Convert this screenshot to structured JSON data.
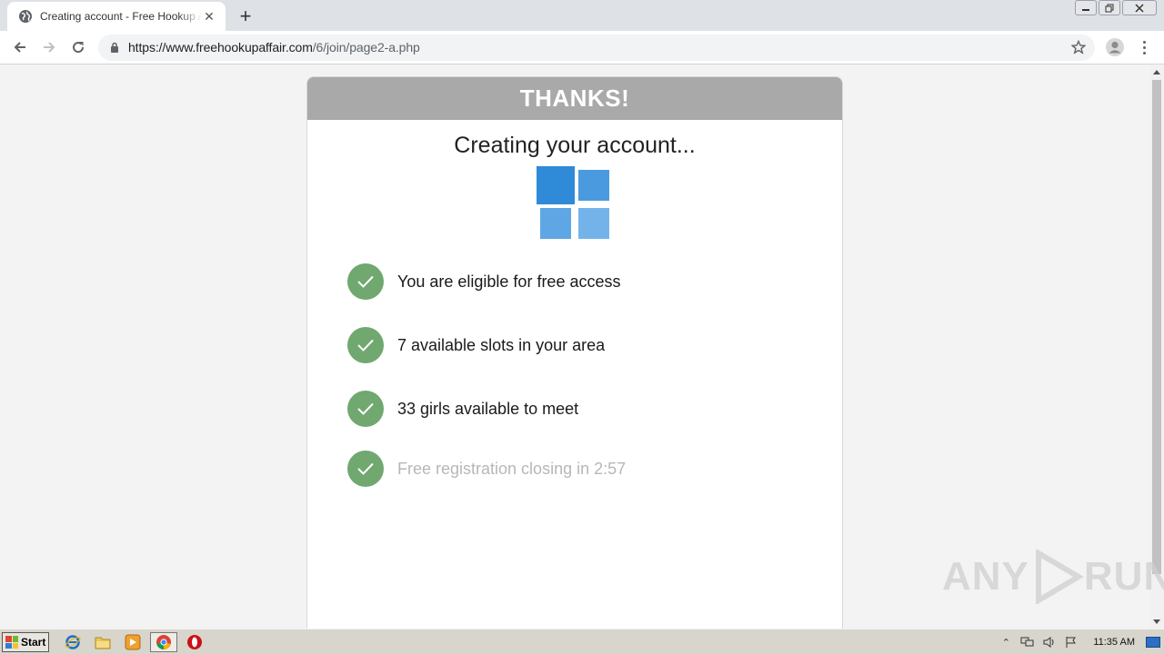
{
  "browser": {
    "tab_title": "Creating account - Free Hookup Affair",
    "url_host": "https://www.freehookupaffair.com",
    "url_path": "/6/join/page2-a.php"
  },
  "page": {
    "header": "THANKS!",
    "subtitle": "Creating your account...",
    "checklist": [
      {
        "text": "You are eligible for free access",
        "state": "done"
      },
      {
        "text": "7 available slots in your area",
        "state": "done"
      },
      {
        "text": "33 girls available to meet",
        "state": "done"
      },
      {
        "text": "Free registration closing in 2:57",
        "state": "pending"
      }
    ],
    "colors": {
      "header_bg": "#a9a9a9",
      "check_green": "#70a870",
      "spinner_blue": "#2f8ad8"
    }
  },
  "watermark": {
    "left": "ANY",
    "right": "RUN"
  },
  "taskbar": {
    "start_label": "Start",
    "clock": "11:35 AM",
    "apps": [
      "internet-explorer-icon",
      "explorer-folder-icon",
      "media-player-icon",
      "chrome-icon",
      "opera-icon"
    ]
  }
}
